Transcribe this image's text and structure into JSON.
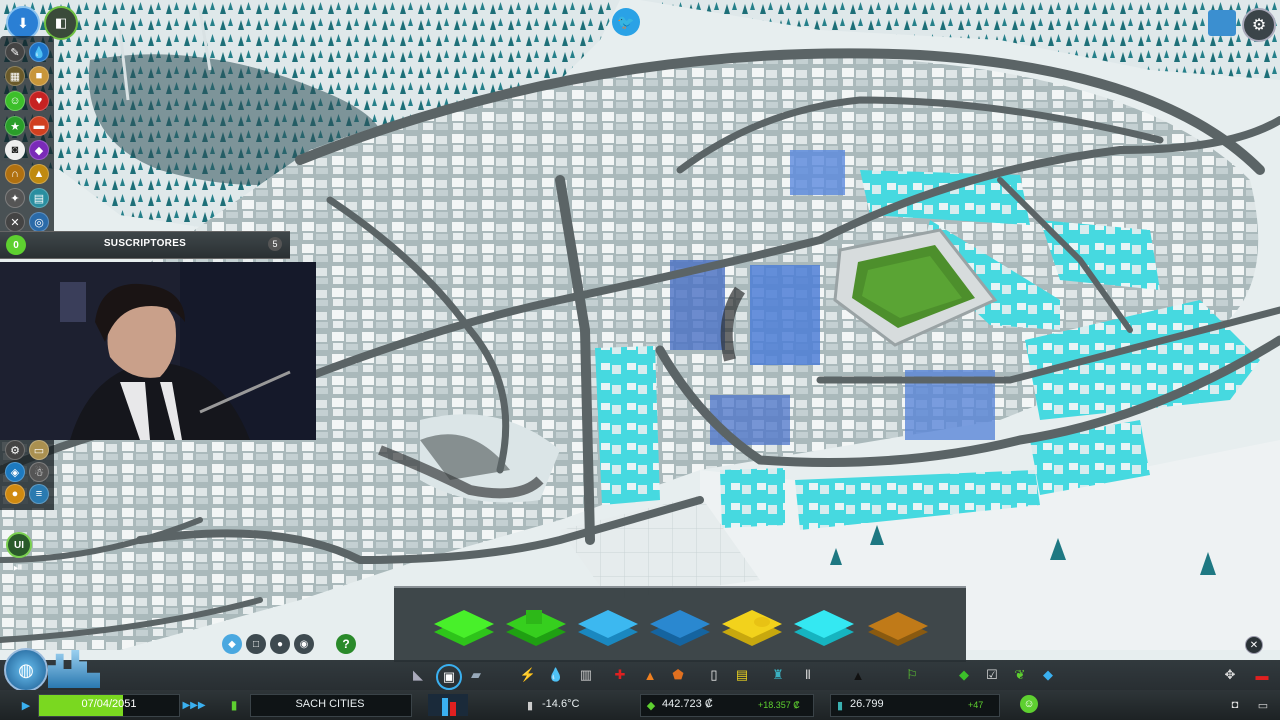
{
  "overlay": {
    "subscribers_label": "SUSCRIPTORES",
    "subscribers_left": "0",
    "subscribers_right": "5"
  },
  "status_bar": {
    "date": "07/04/2051",
    "city_name": "SACH CITIES",
    "temperature": "-14.6°C",
    "money": "442.723 ₡",
    "income": "+18.357 ₡",
    "population": "26.799",
    "population_change": "+47",
    "date_progress": 0.6
  },
  "toolbar": {
    "ui_label": "UI"
  },
  "zone_tiles": [
    {
      "name": "residential-low",
      "color": "#3bdc22"
    },
    {
      "name": "residential-high",
      "color": "#2eb81c"
    },
    {
      "name": "commercial-low",
      "color": "#36b6f0"
    },
    {
      "name": "commercial-high",
      "color": "#2a8ed0"
    },
    {
      "name": "industrial",
      "color": "#f2d21c"
    },
    {
      "name": "office",
      "color": "#28e8f2"
    },
    {
      "name": "dezone",
      "color": "#c07a18"
    }
  ],
  "colors": {
    "snow": "#eef3f4",
    "road": "#5d6466",
    "forest": "#1b6a73",
    "highlight": "#3fe7ef",
    "money_green": "#5ed030"
  }
}
